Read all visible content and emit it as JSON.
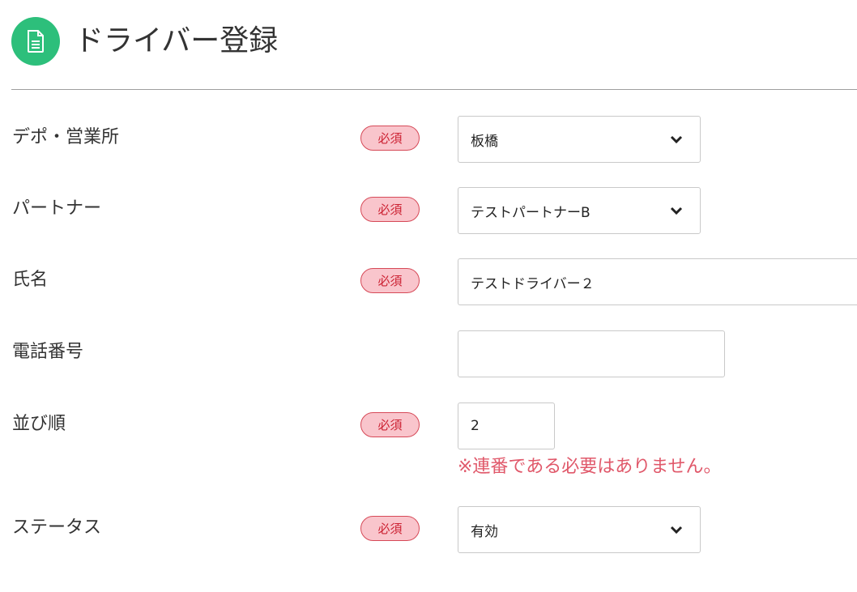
{
  "header": {
    "title": "ドライバー登録",
    "icon": "document-icon",
    "icon_color": "#2dbf7b"
  },
  "form": {
    "required_label": "必須",
    "accent_color": "#e0586a",
    "fields": [
      {
        "label": "デポ・営業所",
        "type": "select",
        "value": "板橋",
        "required": true
      },
      {
        "label": "パートナー",
        "type": "select",
        "value": "テストパートナーB",
        "required": true
      },
      {
        "label": "氏名",
        "type": "text",
        "value": "テストドライバー２",
        "required": true
      },
      {
        "label": "電話番号",
        "type": "text",
        "value": "",
        "required": false
      },
      {
        "label": "並び順",
        "type": "number",
        "value": "2",
        "required": true,
        "hint": "※連番である必要はありません。"
      },
      {
        "label": "ステータス",
        "type": "select",
        "value": "有効",
        "required": true
      }
    ]
  }
}
